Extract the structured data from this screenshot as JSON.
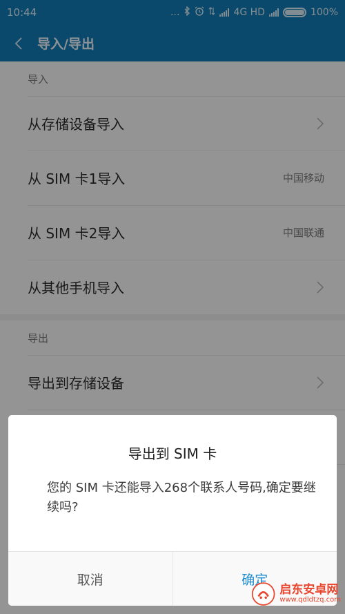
{
  "status_bar": {
    "time": "10:44",
    "dots": "...",
    "network": "4G HD",
    "battery_text": "100%",
    "battery_level": 1.0
  },
  "action_bar": {
    "title": "导入/导出"
  },
  "import_section": {
    "header": "导入",
    "items": [
      {
        "label": "从存储设备导入",
        "secondary": ""
      },
      {
        "label": "从 SIM 卡1导入",
        "secondary": "中国移动"
      },
      {
        "label": "从 SIM 卡2导入",
        "secondary": "中国联通"
      },
      {
        "label": "从其他手机导入",
        "secondary": ""
      }
    ]
  },
  "export_section": {
    "header": "导出",
    "items": [
      {
        "label": "导出到存储设备"
      },
      {
        "label": ""
      },
      {
        "label": ""
      }
    ]
  },
  "dialog": {
    "title": "导出到  SIM  卡",
    "message": "您的 SIM 卡还能导入268个联系人号码,确定要继续吗?",
    "cancel_label": "取消",
    "ok_label": "确定"
  },
  "watermark": {
    "name": "启东安卓网",
    "url": "www.qdldtzq.com"
  },
  "colors": {
    "accent": "#117bb3",
    "dialog_ok": "#1a8ad1",
    "watermark": "#e8452c"
  }
}
